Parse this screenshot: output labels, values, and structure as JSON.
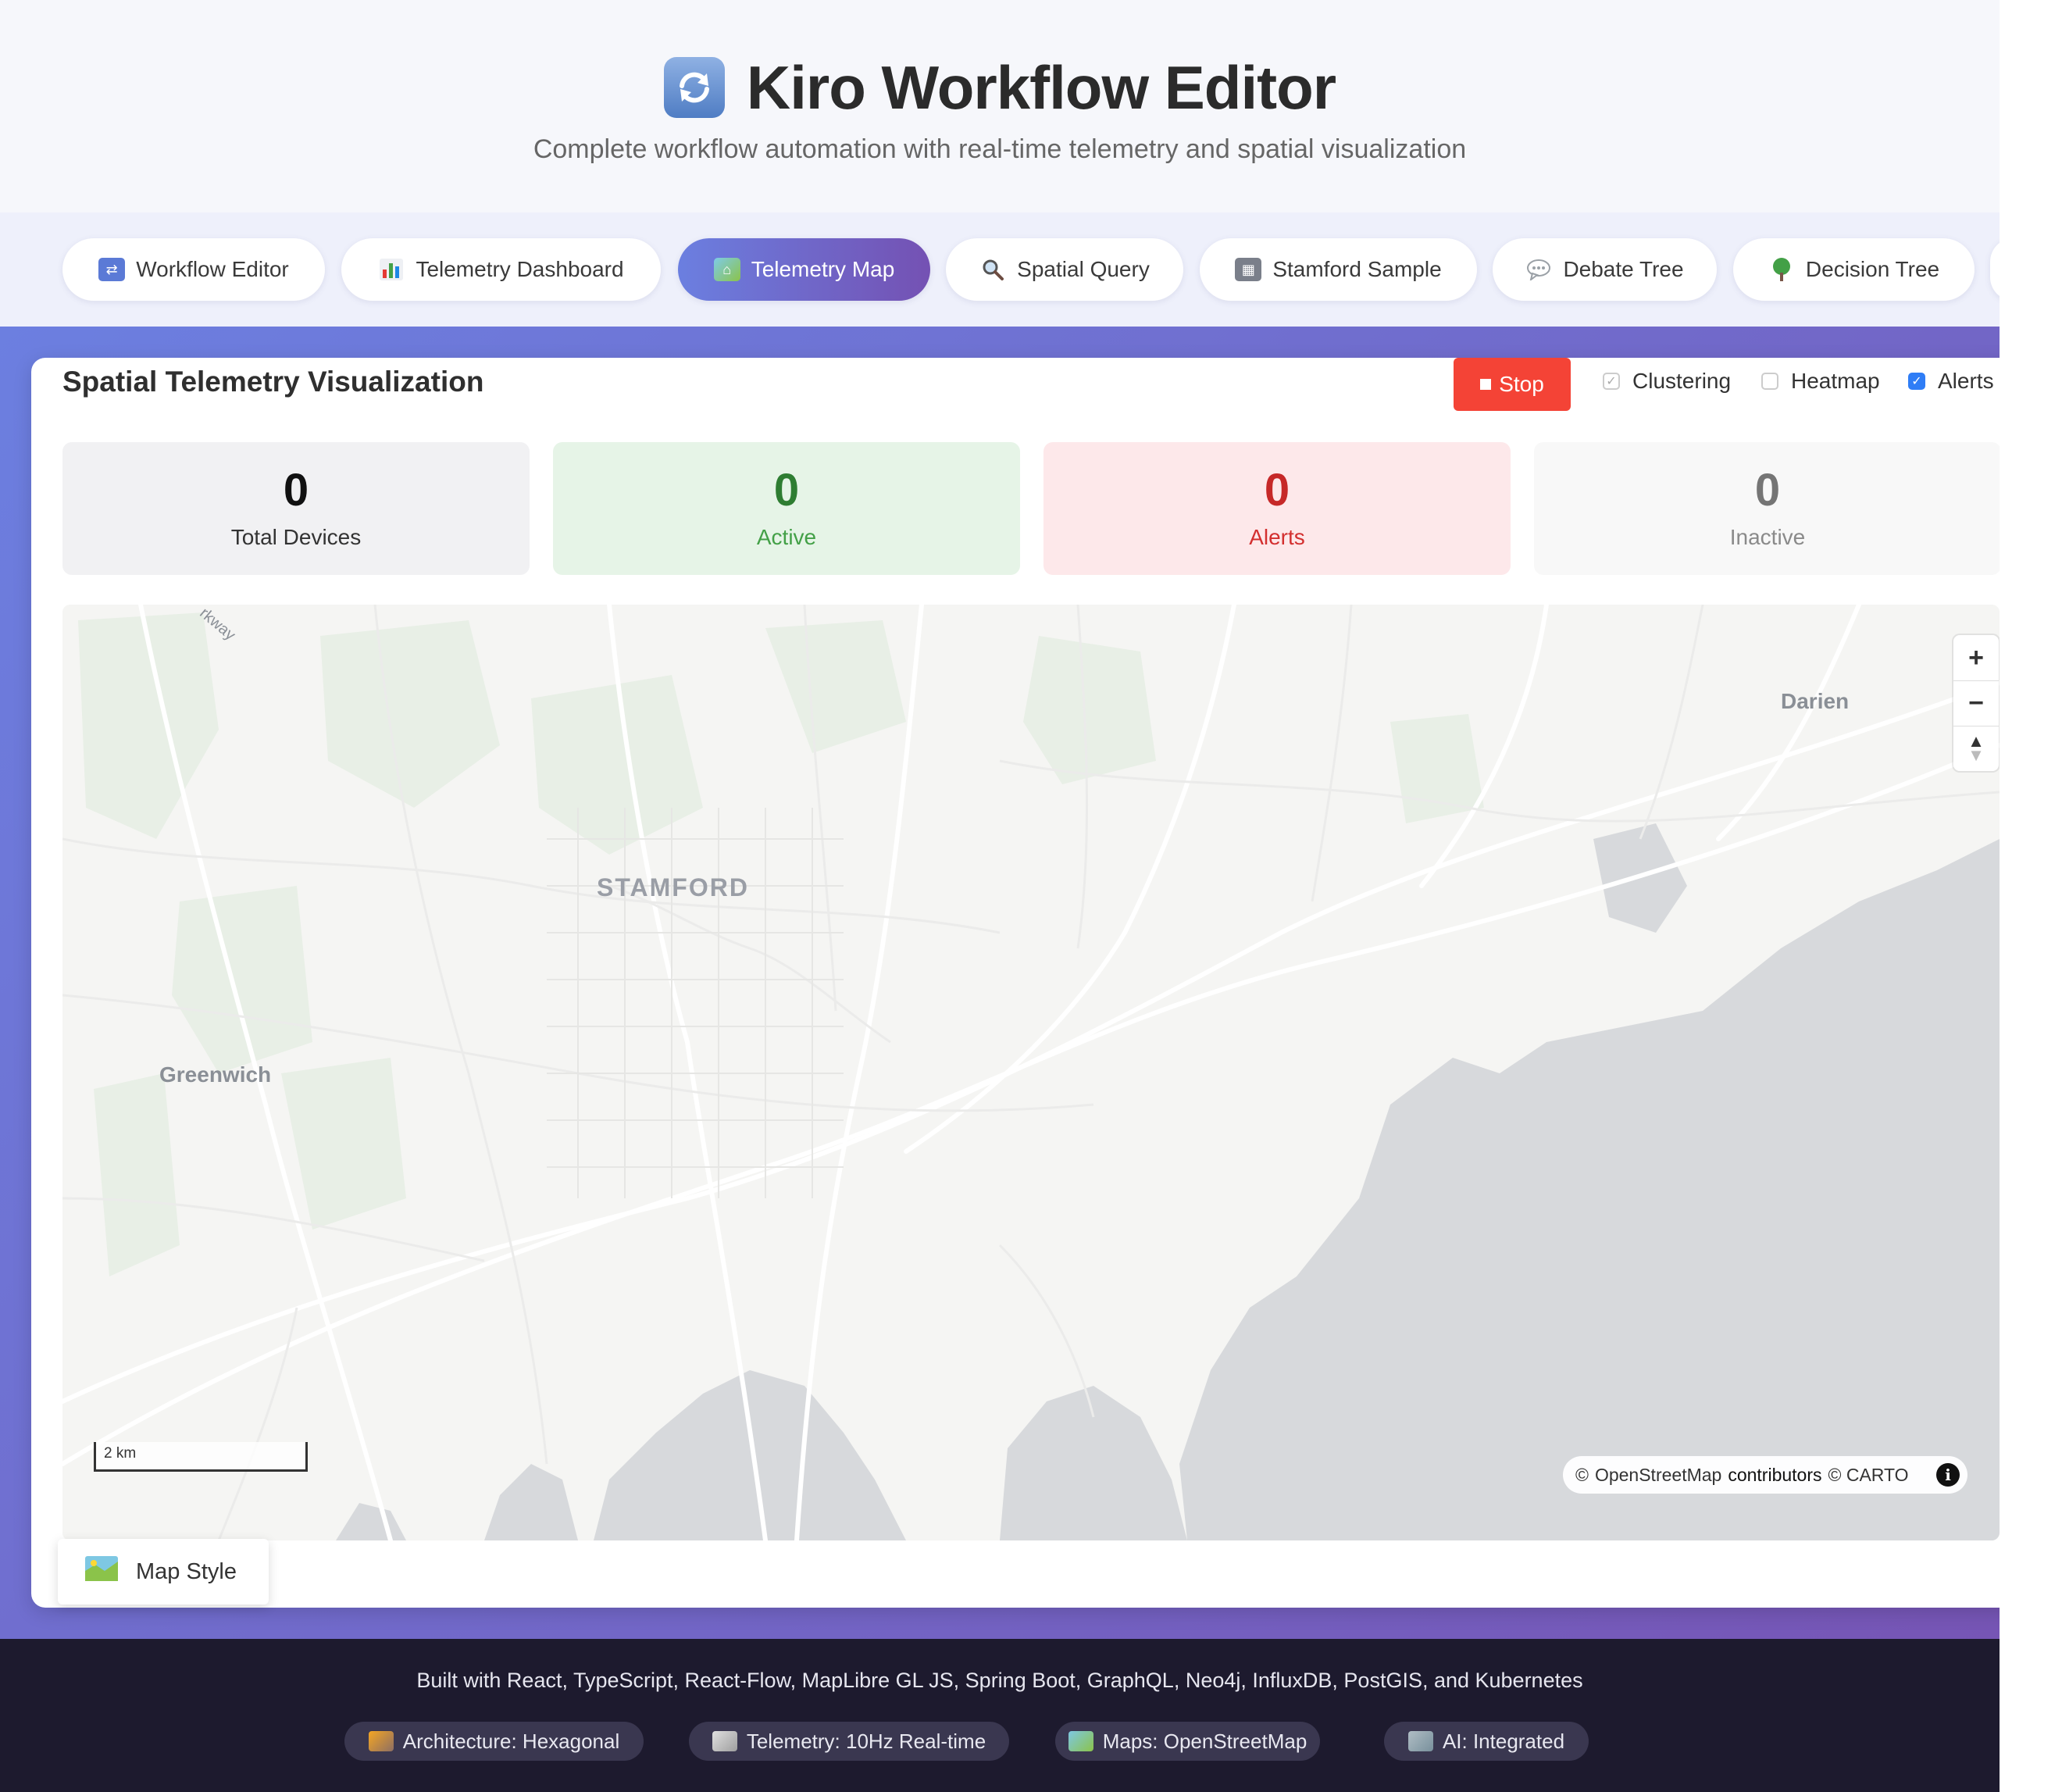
{
  "header": {
    "title": "Kiro Workflow Editor",
    "subtitle": "Complete workflow automation with real-time telemetry and spatial visualization",
    "icon": "refresh-arrows-icon"
  },
  "tabs": [
    {
      "label": "Workflow Editor",
      "icon": "shuffle-icon",
      "active": false
    },
    {
      "label": "Telemetry Dashboard",
      "icon": "bar-chart-icon",
      "active": false
    },
    {
      "label": "Telemetry Map",
      "icon": "map-icon",
      "active": true
    },
    {
      "label": "Spatial Query",
      "icon": "magnifier-icon",
      "active": false
    },
    {
      "label": "Stamford Sample",
      "icon": "office-building-icon",
      "active": false
    },
    {
      "label": "Debate Tree",
      "icon": "speech-bubble-icon",
      "active": false
    },
    {
      "label": "Decision Tree",
      "icon": "tree-icon",
      "active": false
    }
  ],
  "panel": {
    "title": "Spatial Telemetry Visualization",
    "stop_label": "Stop",
    "toggles": [
      {
        "label": "Clustering",
        "checked": true,
        "dimmed": true
      },
      {
        "label": "Heatmap",
        "checked": false
      },
      {
        "label": "Alerts",
        "checked": true
      }
    ]
  },
  "stats": [
    {
      "value": "0",
      "label": "Total Devices"
    },
    {
      "value": "0",
      "label": "Active"
    },
    {
      "value": "0",
      "label": "Alerts"
    },
    {
      "value": "0",
      "label": "Inactive"
    }
  ],
  "map": {
    "places": {
      "city": "STAMFORD",
      "north_east": "Darien",
      "south_west": "Greenwich",
      "road": "rkway"
    },
    "scale_label": "2 km",
    "attribution": {
      "prefix": "©",
      "osm": "OpenStreetMap",
      "contributors": "contributors",
      "carto": "© CARTO"
    },
    "zoom_in": "+",
    "zoom_out": "−",
    "compass": "▲",
    "info": "i",
    "style_button": "Map Style"
  },
  "footer": {
    "text": "Built with React, TypeScript, React-Flow, MapLibre GL JS, Spring Boot, GraphQL, Neo4j, InfluxDB, PostGIS, and Kubernetes",
    "badges": [
      {
        "label": "Architecture: Hexagonal",
        "icon": "construction-crane-icon"
      },
      {
        "label": "Telemetry: 10Hz Real-time",
        "icon": "satellite-dish-icon"
      },
      {
        "label": "Maps: OpenStreetMap",
        "icon": "map-icon"
      },
      {
        "label": "AI: Integrated",
        "icon": "robot-icon"
      }
    ]
  },
  "colors": {
    "accent_start": "#6c7fe0",
    "accent_end": "#7655b5",
    "stop": "#f44336",
    "active_bg": "#e6f4e7",
    "active_text": "#2e7d32",
    "alert_bg": "#fde8ea",
    "alert_text": "#c62828",
    "inactive_text": "#757575",
    "footer_bg": "#1d1a2e"
  }
}
